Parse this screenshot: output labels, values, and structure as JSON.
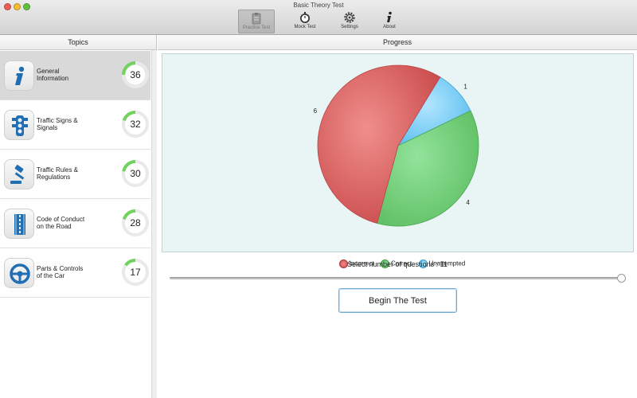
{
  "window": {
    "title": "Basic Theory Test",
    "controls": {
      "close": "#ee5e57",
      "minimize": "#f5bd32",
      "zoom": "#5fc33f"
    }
  },
  "toolbar": {
    "items": [
      {
        "label": "Practice Test",
        "icon": "clipboard-icon",
        "active": true
      },
      {
        "label": "Mock Test",
        "icon": "stopwatch-icon",
        "active": false
      },
      {
        "label": "Settings",
        "icon": "gear-icon",
        "active": false
      },
      {
        "label": "About",
        "icon": "info-icon",
        "active": false
      }
    ]
  },
  "topics": {
    "header": "Topics",
    "items": [
      {
        "label_line1": "General",
        "label_line2": "Information",
        "count": "36",
        "icon": "info-icon",
        "progress": 0.25,
        "selected": true
      },
      {
        "label_line1": "Traffic Signs &",
        "label_line2": "Signals",
        "count": "32",
        "icon": "traffic-light-icon",
        "progress": 0.2,
        "selected": false
      },
      {
        "label_line1": "Traffic Rules &",
        "label_line2": "Regulations",
        "count": "30",
        "icon": "gavel-icon",
        "progress": 0.22,
        "selected": false
      },
      {
        "label_line1": "Code of Conduct",
        "label_line2": "on the Road",
        "count": "28",
        "icon": "road-icon",
        "progress": 0.2,
        "selected": false
      },
      {
        "label_line1": "Parts & Controls",
        "label_line2": "of the Car",
        "count": "17",
        "icon": "steering-wheel-icon",
        "progress": 0.15,
        "selected": false
      }
    ]
  },
  "progress": {
    "header": "Progress",
    "legend": [
      {
        "label": "Incorrect",
        "color": "#d9534f"
      },
      {
        "label": "Correct",
        "color": "#5cb85c"
      },
      {
        "label": "Unattempted",
        "color": "#5bc0de"
      }
    ],
    "select_label": "Select number of questions : 11",
    "slider_value": 11,
    "begin_button": "Begin The Test"
  },
  "chart_data": {
    "type": "pie",
    "categories": [
      "Incorrect",
      "Correct",
      "Unattempted"
    ],
    "values": [
      6,
      4,
      1
    ],
    "colors": [
      "#d9534f",
      "#5cb85c",
      "#5bc0de"
    ],
    "labels": [
      "6",
      "4",
      "1"
    ]
  }
}
